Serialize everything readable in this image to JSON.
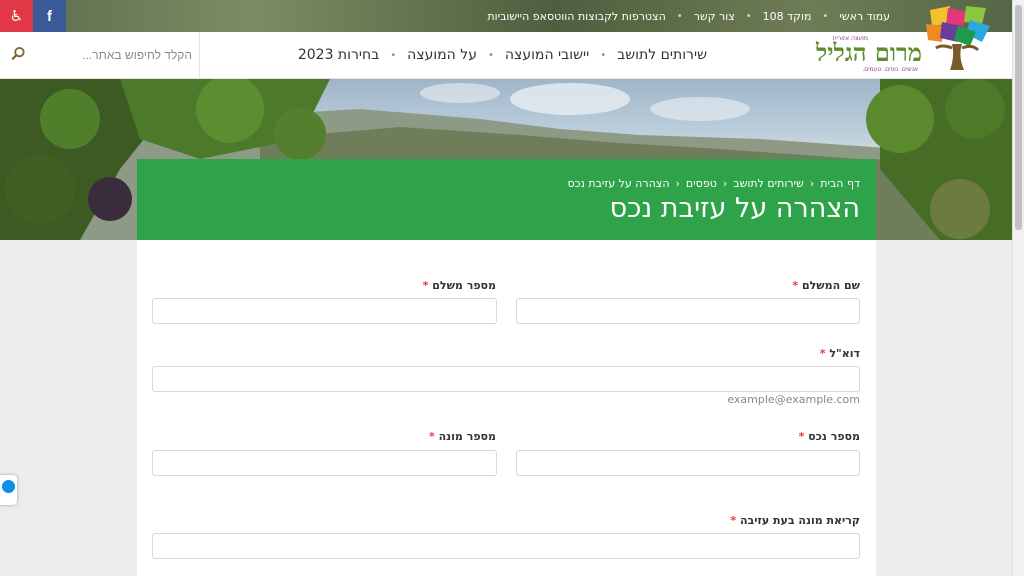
{
  "topbar": {
    "links": [
      "עמוד ראשי",
      "מוקד 108",
      "צור קשר",
      "הצטרפות לקבוצות הווטסאפ היישוביות"
    ],
    "social": {
      "accessibility_icon": "accessibility-icon",
      "facebook_icon": "facebook-icon",
      "facebook_glyph": "f",
      "accessibility_glyph": "♿"
    }
  },
  "header": {
    "logo": {
      "name": "מרום הגליל",
      "top_text": "מועצה אזורית",
      "tagline": "אנשים. נופים. טעמים."
    },
    "nav": [
      "שירותים לתושב",
      "יישובי המועצה",
      "על המועצה",
      "בחירות 2023"
    ],
    "search": {
      "placeholder": "הקלד לחיפוש באתר..."
    }
  },
  "breadcrumb": [
    "דף הבית",
    "שירותים לתושב",
    "טפסים",
    "הצהרה על עזיבת נכס"
  ],
  "page_title": "הצהרה על עזיבת נכס",
  "form": {
    "payer_name_label": "שם המשלם",
    "payer_number_label": "מספר משלם",
    "email_label": "דוא\"ל",
    "email_hint": "example@example.com",
    "property_number_label": "מספר נכס",
    "meter_number_label": "מספר מונה",
    "meter_reading_label": "קריאת מונה בעת עזיבה",
    "required_mark": "*"
  },
  "colors": {
    "accent_green": "#2ea34a",
    "required": "#e53935",
    "facebook": "#3a5998",
    "accessibility": "#e23744"
  }
}
